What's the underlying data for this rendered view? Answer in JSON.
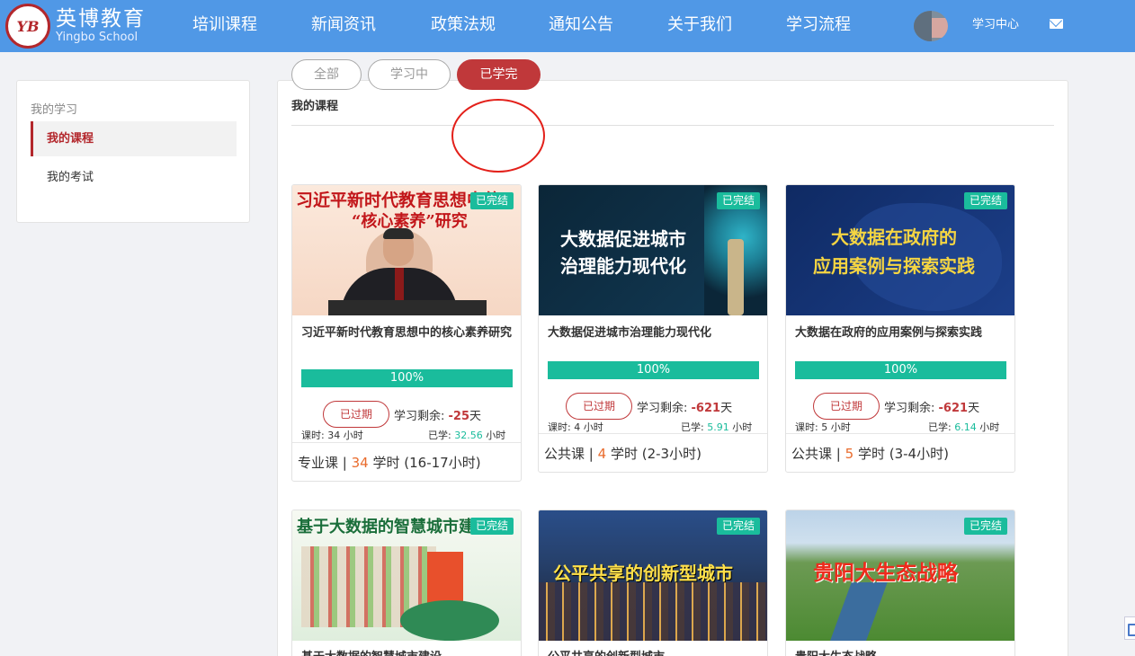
{
  "header": {
    "logo_badge": "YB",
    "logo_cn": "英博教育",
    "logo_en": "Yingbo School",
    "nav": [
      "培训课程",
      "新闻资讯",
      "政策法规",
      "通知公告",
      "关于我们",
      "学习流程"
    ],
    "study_center": "学习中心",
    "brand_color": "#5098e6"
  },
  "sidebar": {
    "title": "我的学习",
    "items": [
      {
        "label": "我的课程",
        "active": true
      },
      {
        "label": "我的考试",
        "active": false
      }
    ],
    "accent": "#b3272c"
  },
  "main": {
    "title": "我的课程",
    "tabs": [
      {
        "label": "全部",
        "active": false
      },
      {
        "label": "学习中",
        "active": false
      },
      {
        "label": "已学完",
        "active": true
      }
    ]
  },
  "courses": [
    {
      "badge": "已完结",
      "thumb_lines": [
        "习近平新时代教育思想中的",
        "“核心素养”研究"
      ],
      "title": "习近平新时代教育思想中的核心素养研究",
      "progress": "100%",
      "expired": "已过期",
      "remain_label": "学习剩余:",
      "remain_value": "-25",
      "remain_unit": "天",
      "hours_label": "课时: 34 小时",
      "learned_label": "已学:",
      "learned_value": "32.56",
      "learned_unit": "小时",
      "type": "专业课",
      "credit": "34",
      "credit_label": "学时",
      "duration": "(16-17小时)"
    },
    {
      "badge": "已完结",
      "thumb_lines": [
        "大数据促进城市",
        "治理能力现代化"
      ],
      "title": "大数据促进城市治理能力现代化",
      "progress": "100%",
      "expired": "已过期",
      "remain_label": "学习剩余:",
      "remain_value": "-621",
      "remain_unit": "天",
      "hours_label": "课时: 4 小时",
      "learned_label": "已学:",
      "learned_value": "5.91",
      "learned_unit": "小时",
      "type": "公共课",
      "credit": "4",
      "credit_label": "学时",
      "duration": "(2-3小时)"
    },
    {
      "badge": "已完结",
      "thumb_lines": [
        "大数据在政府的",
        "应用案例与探索实践"
      ],
      "title": "大数据在政府的应用案例与探索实践",
      "progress": "100%",
      "expired": "已过期",
      "remain_label": "学习剩余:",
      "remain_value": "-621",
      "remain_unit": "天",
      "hours_label": "课时: 5 小时",
      "learned_label": "已学:",
      "learned_value": "6.14",
      "learned_unit": "小时",
      "type": "公共课",
      "credit": "5",
      "credit_label": "学时",
      "duration": "(3-4小时)"
    },
    {
      "badge": "已完结",
      "thumb_lines": [
        "基于大数据的智慧城市建设"
      ],
      "title": "基于大数据的智慧城市建设"
    },
    {
      "badge": "已完结",
      "thumb_lines": [
        "公平共享的创新型城市"
      ],
      "title": "公平共享的创新型城市"
    },
    {
      "badge": "已完结",
      "thumb_lines": [
        "贵阳大生态战略"
      ],
      "title": "贵阳大生态战略"
    }
  ]
}
